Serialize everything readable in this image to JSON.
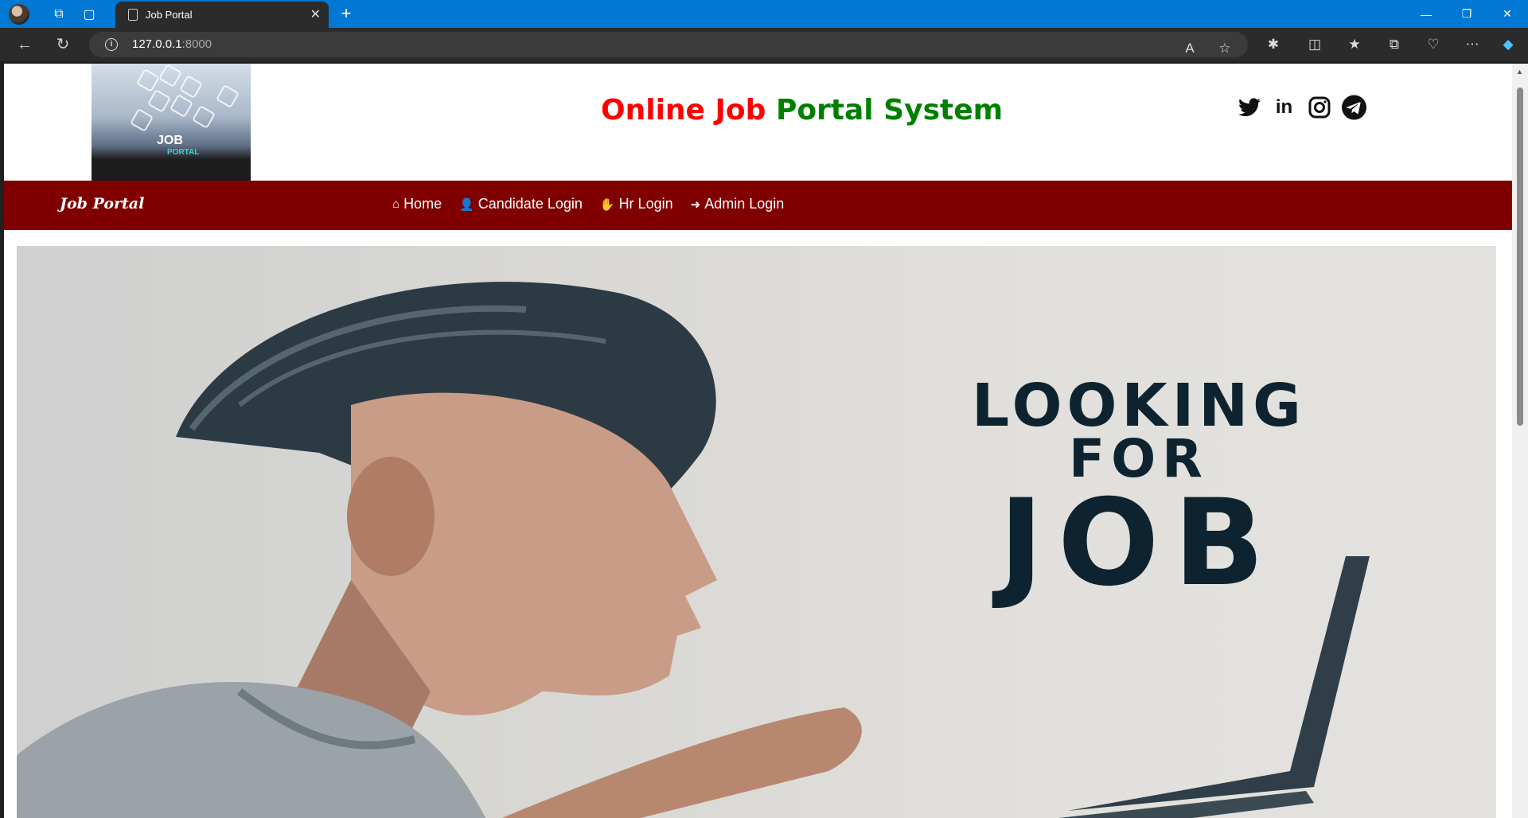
{
  "browser": {
    "tab_title": "Job Portal",
    "url_host": "127.0.0.1",
    "url_port": ":8000"
  },
  "header": {
    "title_part1": "Online Job",
    "title_part2": "Portal System",
    "logo_text": "JOB",
    "logo_sub": "PORTAL",
    "socials": [
      "twitter-icon",
      "linkedin-icon",
      "instagram-icon",
      "telegram-icon"
    ],
    "title_colors": {
      "part1": "#ff0000",
      "part2": "#007f00"
    }
  },
  "navbar": {
    "brand": "Job Portal",
    "color": "#800000",
    "items": [
      {
        "label": "Home",
        "icon": "home-icon"
      },
      {
        "label": "Candidate Login",
        "icon": "user-plus-icon"
      },
      {
        "label": "Hr Login",
        "icon": "handshake-icon"
      },
      {
        "label": "Admin Login",
        "icon": "sign-in-icon"
      }
    ]
  },
  "hero": {
    "line1": "LOOKING",
    "line2": "FOR",
    "line3": "JOB"
  }
}
